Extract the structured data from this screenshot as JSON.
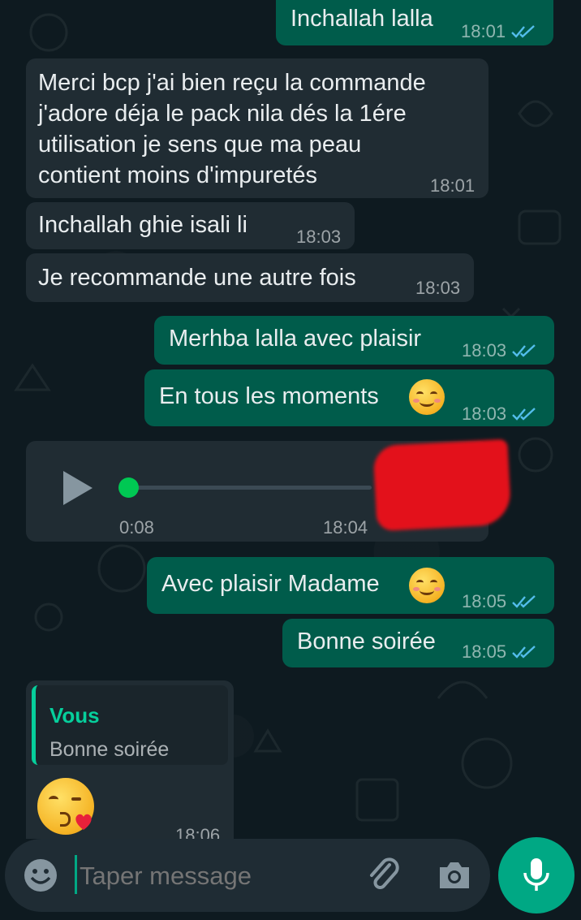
{
  "chat": {
    "messages": [
      {
        "id": "m1",
        "direction": "out",
        "text": "Inchallah lalla",
        "time": "18:01",
        "read": true
      },
      {
        "id": "m2",
        "direction": "in",
        "text": "Merci bcp j'ai bien reçu la commande\nj'adore déja le pack nila dés la 1ére\nutilisation je sens que ma peau\ncontient moins d'impuretés",
        "time": "18:01"
      },
      {
        "id": "m3",
        "direction": "in",
        "text": "Inchallah ghie isali li",
        "time": "18:03"
      },
      {
        "id": "m4",
        "direction": "in",
        "text": "Je recommande une autre fois",
        "time": "18:03"
      },
      {
        "id": "m5",
        "direction": "out",
        "text": "Merhba lalla avec plaisir",
        "time": "18:03",
        "read": true
      },
      {
        "id": "m6",
        "direction": "out",
        "text": "En tous les moments",
        "emoji": "smiling-face-icon",
        "time": "18:03",
        "read": true
      },
      {
        "id": "m7",
        "direction": "in",
        "type": "voice",
        "duration": "0:08",
        "time": "18:04",
        "progress": 0.0
      },
      {
        "id": "m8",
        "direction": "out",
        "text": "Avec plaisir Madame",
        "emoji": "smiling-face-icon",
        "time": "18:05",
        "read": true
      },
      {
        "id": "m9",
        "direction": "out",
        "text": "Bonne soirée",
        "time": "18:05",
        "read": true
      },
      {
        "id": "m10",
        "direction": "in",
        "type": "reply",
        "quote_author": "Vous",
        "quote_text": "Bonne soirée",
        "emoji": "kissing-face-heart-icon",
        "time": "18:06"
      }
    ]
  },
  "composer": {
    "placeholder": "Taper message",
    "emoji_icon": "emoji-icon",
    "attach_icon": "paperclip-icon",
    "camera_icon": "camera-icon",
    "mic_icon": "microphone-icon"
  },
  "colors": {
    "background": "#0b141a",
    "incoming_bubble": "#202c33",
    "outgoing_bubble": "#005c4b",
    "accent": "#00a884",
    "read_ticks": "#53bdeb",
    "quote_author": "#06cf9c"
  }
}
